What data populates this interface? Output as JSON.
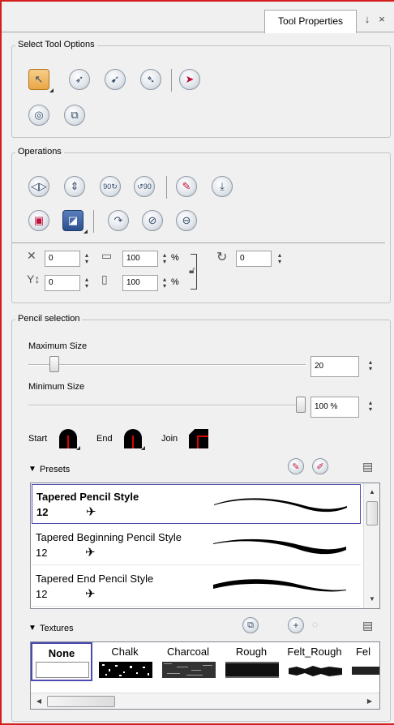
{
  "tab": {
    "title": "Tool Properties",
    "ctrl_pin": "↓",
    "ctrl_close": "×"
  },
  "select_tool_options": {
    "title": "Select Tool Options",
    "tools": [
      "select-by-color-icon",
      "lasso-icon",
      "snap-contour-icon",
      "snap-and-align-icon",
      "select-arrow-icon",
      "apply-to-all-drawings-icon",
      "create-drawing-icon"
    ]
  },
  "operations": {
    "title": "Operations",
    "row1": [
      "flip-horizontal-icon",
      "flip-vertical-icon",
      "rotate-90-cw-icon",
      "rotate-90-ccw-icon",
      "pencil-to-brush-icon",
      "flatten-icon"
    ],
    "row2": [
      "merge-palette-icon",
      "smooth-icon",
      "distort-icon",
      "convert-pencil-icon",
      "adjust-edge-icon"
    ],
    "x_value": "0",
    "y_value": "0",
    "width_value": "100",
    "height_value": "100",
    "angle_value": "0",
    "percent": "%"
  },
  "pencil_selection": {
    "title": "Pencil selection",
    "max_label": "Maximum Size",
    "max_value": "20",
    "max_fraction": 0.08,
    "min_label": "Minimum Size",
    "min_value": "100 %",
    "min_fraction": 1.0,
    "start_label": "Start",
    "end_label": "End",
    "join_label": "Join"
  },
  "presets": {
    "header": "Presets",
    "items": [
      {
        "name": "Tapered Pencil Style",
        "size": "12",
        "selected": true
      },
      {
        "name": "Tapered Beginning Pencil Style",
        "size": "12",
        "selected": false
      },
      {
        "name": "Tapered End Pencil Style",
        "size": "12",
        "selected": false
      }
    ]
  },
  "textures": {
    "header": "Textures",
    "items": [
      "None",
      "Chalk",
      "Charcoal",
      "Rough",
      "Felt_Rough",
      "Fel"
    ]
  },
  "colors": {
    "accent_red": "#d41e1e",
    "selection_border": "#4a4ab0"
  }
}
